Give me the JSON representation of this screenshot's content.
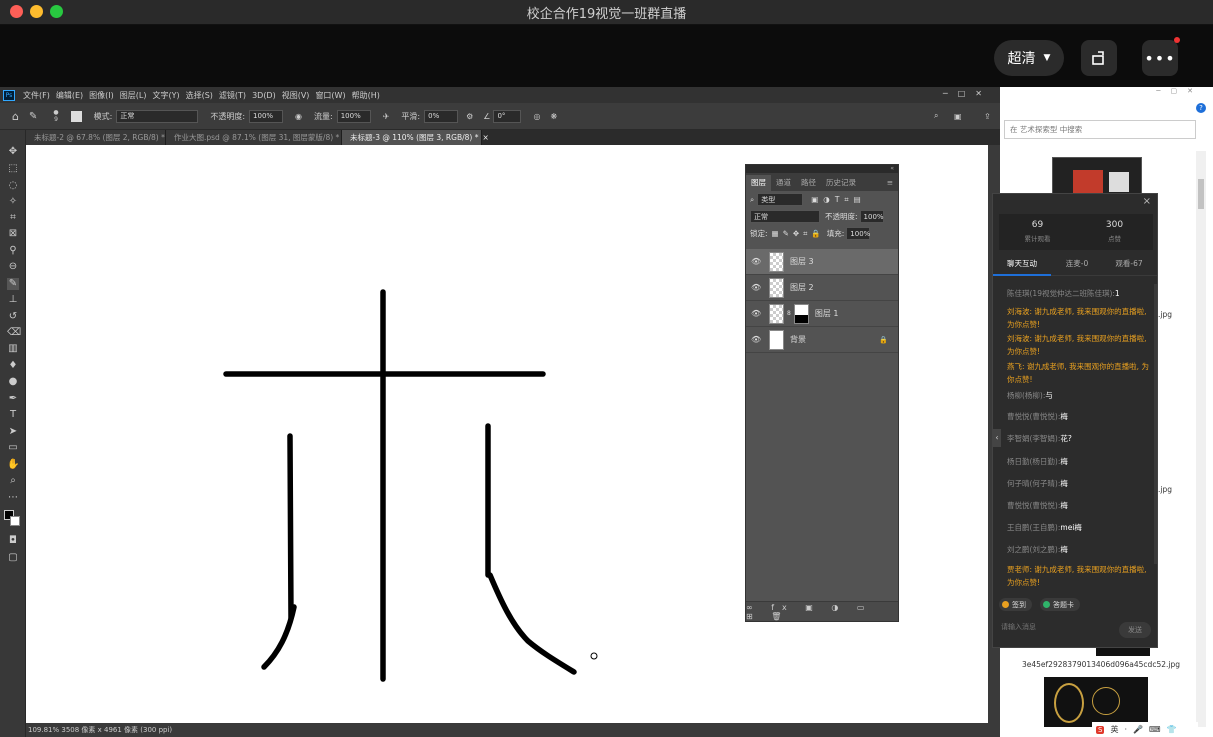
{
  "window": {
    "title": "校企合作19视觉一班群直播"
  },
  "live": {
    "quality": "超清"
  },
  "ps": {
    "menu": [
      "文件(F)",
      "编辑(E)",
      "图像(I)",
      "图层(L)",
      "文字(Y)",
      "选择(S)",
      "滤镜(T)",
      "3D(D)",
      "视图(V)",
      "窗口(W)",
      "帮助(H)"
    ],
    "options": {
      "brush_size": "9",
      "mode_label": "模式:",
      "mode_value": "正常",
      "opacity_label": "不透明度:",
      "opacity_value": "100%",
      "flow_label": "流量:",
      "flow_value": "100%",
      "smooth_label": "平滑:",
      "smooth_value": "0%",
      "angle_value": "0°"
    },
    "tabs": [
      "未标题-2 @ 67.8% (图层 2, RGB/8) *",
      "作业大图.psd @ 87.1% (图层 31, 图层蒙版/8) *",
      "未标题-3 @ 110% (图层 3, RGB/8) *"
    ],
    "status": "109.81%  3508 像素 x 4961 像素 (300 ppi)",
    "layers_panel": {
      "tabs": [
        "图层",
        "通道",
        "路径",
        "历史记录"
      ],
      "filter_label": "类型",
      "blend_mode": "正常",
      "opacity_label": "不透明度:",
      "opacity_value": "100%",
      "lock_label": "锁定:",
      "fill_label": "填充:",
      "fill_value": "100%",
      "layers": [
        {
          "name": "图层 3",
          "selected": true
        },
        {
          "name": "图层 2",
          "selected": false
        },
        {
          "name": "图层 1",
          "selected": false
        },
        {
          "name": "背景",
          "selected": false
        }
      ]
    }
  },
  "browser": {
    "search_placeholder": "在 艺术探索型 中搜索",
    "files": [
      ".jpg",
      ".jpg",
      "3e45ef2928379013406d096a45cdc52.jpg"
    ]
  },
  "chat": {
    "stats": [
      {
        "value": "69",
        "label": "累计观看"
      },
      {
        "value": "300",
        "label": "点赞"
      }
    ],
    "tabs": [
      "聊天互动",
      "连麦-0",
      "观看-67"
    ],
    "messages": [
      {
        "user": "陈佳琪(19视觉仲达二班陈佳琪):",
        "text": "1",
        "color": "gray"
      },
      {
        "user": "",
        "text": "刘海波: 谢九成老师, 我来围观你的直播啦, 为你点赞!",
        "color": "orange"
      },
      {
        "user": "",
        "text": "刘海波: 谢九成老师, 我来围观你的直播啦, 为你点赞!",
        "color": "orange"
      },
      {
        "user": "",
        "text": "燕飞: 谢九成老师, 我来围观你的直播啦, 为你点赞!",
        "color": "orange"
      },
      {
        "user": "杨柳(杨柳):",
        "text": "与",
        "color": "gray"
      },
      {
        "user": "曹悦悦(曹悦悦):",
        "text": "梅",
        "color": "gray"
      },
      {
        "user": "李智娟(李智娟):",
        "text": "花?",
        "color": "gray"
      },
      {
        "user": "杨日勤(杨日勤):",
        "text": "梅",
        "color": "gray"
      },
      {
        "user": "何子晴(何子晴):",
        "text": "梅",
        "color": "gray"
      },
      {
        "user": "曹悦悦(曹悦悦):",
        "text": "梅",
        "color": "gray"
      },
      {
        "user": "王自鹏(王自鹏):",
        "text": "mei梅",
        "color": "gray"
      },
      {
        "user": "刘之鹏(刘之鹏):",
        "text": "梅",
        "color": "gray"
      },
      {
        "user": "",
        "text": "贾老师: 谢九成老师, 我来围观你的直播啦, 为你点赞!",
        "color": "orange"
      }
    ],
    "actions": [
      "签到",
      "答题卡"
    ],
    "input_placeholder": "请输入消息",
    "send": "发送"
  },
  "colors": {
    "accent": "#1e6fd9",
    "ps_bg": "#535353",
    "orange": "#e8a020"
  }
}
